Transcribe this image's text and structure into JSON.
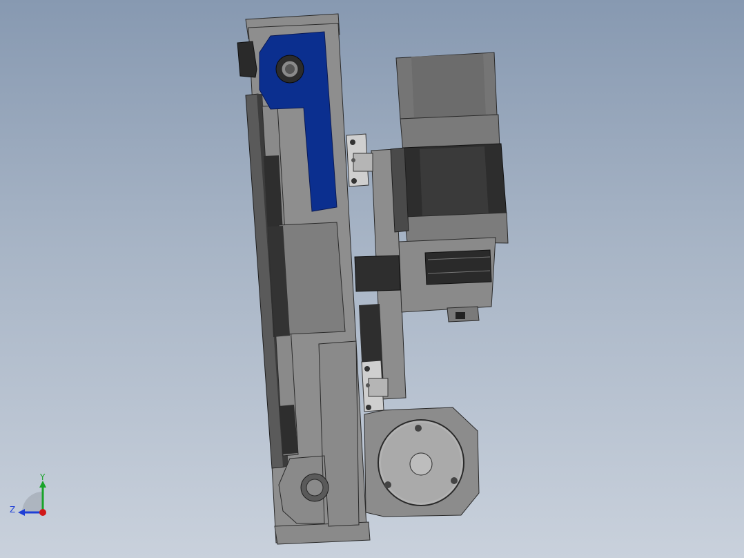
{
  "viewport": {
    "background_top": "#8799b1",
    "background_bottom": "#c9d1dc"
  },
  "model": {
    "highlight_color": "#0b2f8f",
    "part_gray": "#8f8f8f",
    "part_dark": "#2b2b2b"
  },
  "triad": {
    "y_label": "Y",
    "z_label": "Z",
    "y_color": "#1aa32a",
    "z_color": "#1f3fd6",
    "x_color": "#d01818"
  }
}
